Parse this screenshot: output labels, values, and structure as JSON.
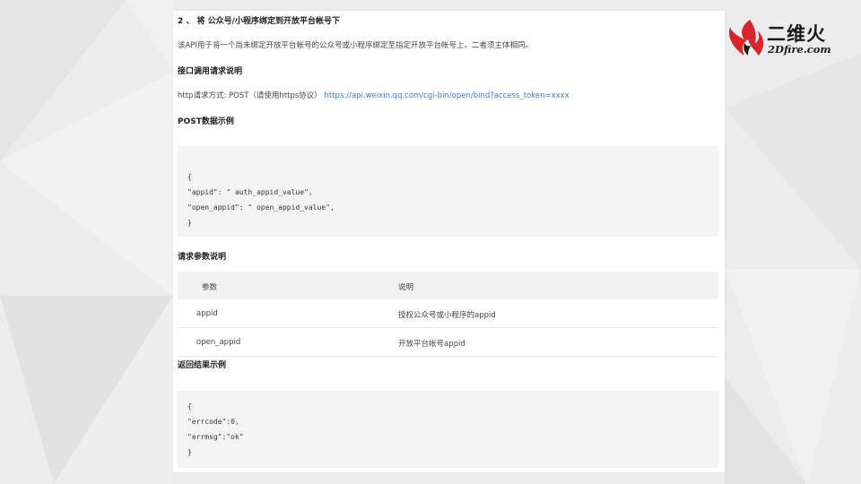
{
  "brand": {
    "name_cn": "二维火",
    "name_en": "2Dfire.com",
    "accent": "#d7262b"
  },
  "section": {
    "title": "2 、 将 公众号/小程序绑定到开放平台帐号下",
    "description": "该API用于将一个尚未绑定开放平台帐号的公众号或小程序绑定至指定开放平台帐号上。二者须主体相同。",
    "api_heading": "接口调用请求说明",
    "request_method": "http请求方式: POST（请使用https协议）",
    "request_url": "https://api.weixin.qq.com/cgi-bin/open/bind?access_token=xxxx",
    "post_heading": "POST数据示例",
    "post_code": [
      "{",
      "\"appid\": \" auth_appid_value\",",
      "\"open_appid\": \" open_appid_value\",",
      "}"
    ],
    "params_heading": "请求参数说明",
    "table": {
      "headers": [
        "参数",
        "说明"
      ],
      "rows": [
        [
          "appid",
          "授权公众号或小程序的appid"
        ],
        [
          "open_appid",
          "开放平台帐号appid"
        ]
      ]
    },
    "result_heading": "返回结果示例",
    "result_code": [
      "{",
      "\"errcode\":0,",
      "\"errmsg\":\"ok\"",
      "}"
    ]
  }
}
